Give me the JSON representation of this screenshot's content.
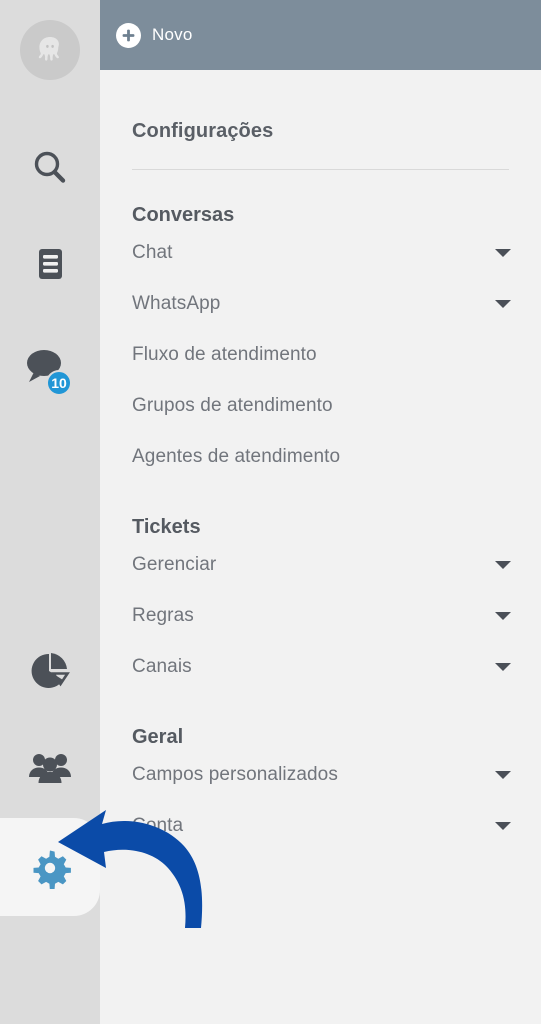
{
  "colors": {
    "rail_bg": "#dcdcdc",
    "panel_bg": "#f2f2f2",
    "topbar_bg": "#7d8d9b",
    "active_tab_bg": "#f5f5f5",
    "badge_blue": "#2196d6",
    "gear_blue": "#4a96c4",
    "arrow_blue": "#0b4ba8",
    "heading_text": "#555a61",
    "item_text": "#71757c"
  },
  "rail": {
    "avatar": {
      "icon": "octopus-avatar-icon"
    },
    "items": [
      {
        "icon": "search-icon",
        "name": "search"
      },
      {
        "icon": "document-icon",
        "name": "documents"
      },
      {
        "icon": "chat-icon",
        "name": "chat",
        "badge": "10"
      },
      {
        "icon": "pie-chart-icon",
        "name": "reports"
      },
      {
        "icon": "users-icon",
        "name": "contacts"
      },
      {
        "icon": "gear-icon",
        "name": "settings",
        "active": true
      }
    ]
  },
  "topbar": {
    "novo_label": "Novo",
    "plus_icon": "plus-circle-icon"
  },
  "panel": {
    "title": "Configurações",
    "sections": [
      {
        "heading": "Conversas",
        "items": [
          {
            "label": "Chat",
            "chevron": true
          },
          {
            "label": "WhatsApp",
            "chevron": true
          },
          {
            "label": "Fluxo de atendimento",
            "chevron": false
          },
          {
            "label": "Grupos de atendimento",
            "chevron": false
          },
          {
            "label": "Agentes de atendimento",
            "chevron": false
          }
        ]
      },
      {
        "heading": "Tickets",
        "items": [
          {
            "label": "Gerenciar",
            "chevron": true
          },
          {
            "label": "Regras",
            "chevron": true
          },
          {
            "label": "Canais",
            "chevron": true
          }
        ]
      },
      {
        "heading": "Geral",
        "items": [
          {
            "label": "Campos personalizados",
            "chevron": true
          },
          {
            "label": "Conta",
            "chevron": true
          }
        ]
      }
    ]
  },
  "annotation": {
    "shape": "curved-arrow-pointing-left",
    "target": "gear-icon"
  }
}
